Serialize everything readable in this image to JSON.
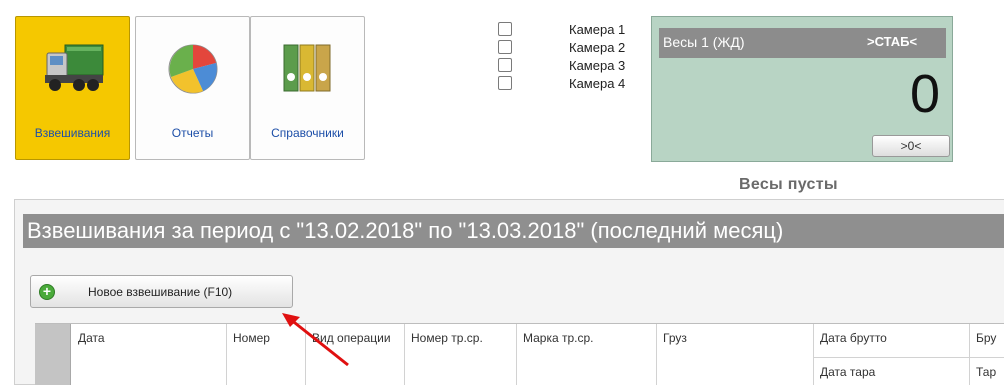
{
  "nav": [
    {
      "label": "Взвешивания",
      "icon": "truck-icon",
      "active": true
    },
    {
      "label": "Отчеты",
      "icon": "pie-chart-icon",
      "active": false
    },
    {
      "label": "Справочники",
      "icon": "binders-icon",
      "active": false
    }
  ],
  "cameras": [
    {
      "label": "Камера 1",
      "checked": false
    },
    {
      "label": "Камера 2",
      "checked": false
    },
    {
      "label": "Камера 3",
      "checked": false
    },
    {
      "label": "Камера 4",
      "checked": false
    }
  ],
  "scale": {
    "name": "Весы 1 (ЖД)",
    "stability": ">СТАБ<",
    "value": "0",
    "zero_button": ">0<",
    "status": "Весы пусты"
  },
  "list": {
    "title": "Взвешивания за период с \"13.02.2018\" по \"13.03.2018\" (последний месяц)",
    "new_button": "Новое взвешивание (F10)"
  },
  "table": {
    "columns": {
      "date": "Дата",
      "number": "Номер",
      "operation_type": "Вид операции",
      "vehicle_number": "Номер тр.ср.",
      "vehicle_brand": "Марка тр.ср.",
      "cargo": "Груз",
      "gross_date": "Дата брутто",
      "tare_date": "Дата тара",
      "gross": "Бру",
      "tare": "Тар"
    }
  },
  "colors": {
    "active_nav": "#f5c800",
    "scale_panel": "#b8d4c4",
    "title_bar": "#8f8f8f",
    "arrow": "#e01010"
  }
}
